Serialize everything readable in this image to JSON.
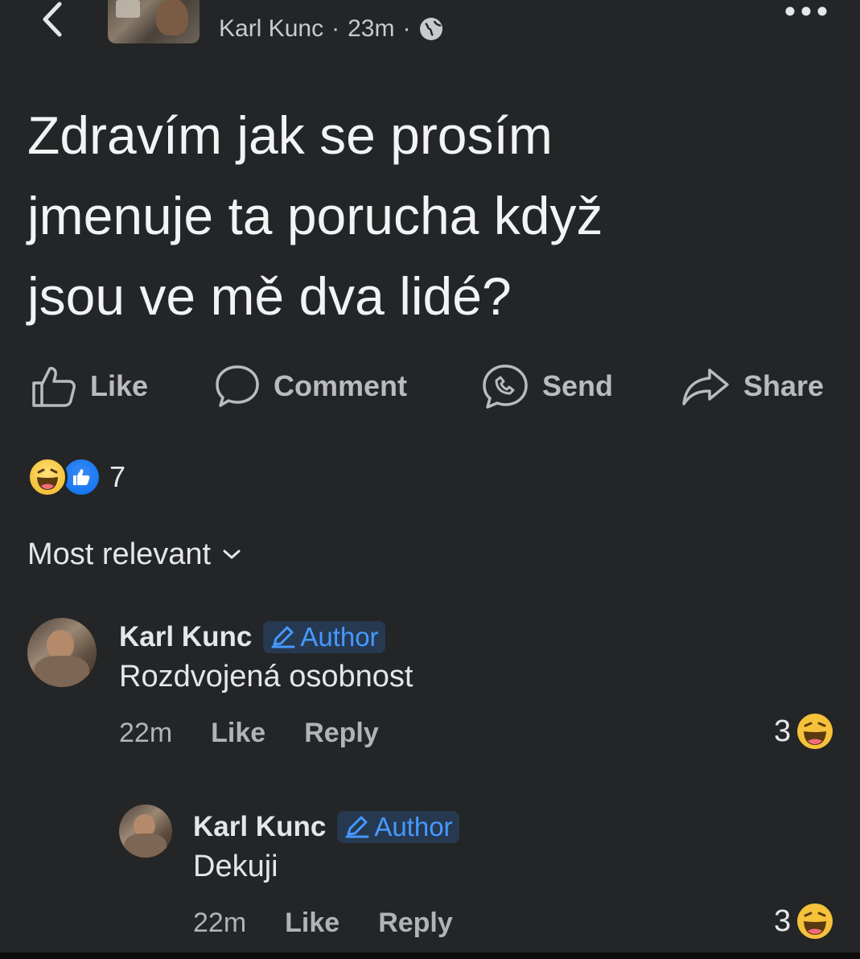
{
  "header": {
    "author": "Karl Kunc",
    "time": "23m",
    "separator": "·",
    "icons": {
      "back": "chevron-left-icon",
      "privacy": "globe-icon",
      "more": "more-horizontal-icon"
    }
  },
  "post": {
    "text": "Zdravím jak se prosím\njmenuje ta porucha když\njsou ve mě dva lidé?"
  },
  "actions": [
    {
      "label": "Like",
      "icon": "thumbs-up-icon"
    },
    {
      "label": "Comment",
      "icon": "comment-bubble-icon"
    },
    {
      "label": "Send",
      "icon": "messenger-icon"
    },
    {
      "label": "Share",
      "icon": "share-arrow-icon"
    }
  ],
  "reactions": {
    "count": "7",
    "types": [
      "haha",
      "like"
    ]
  },
  "sort": {
    "label": "Most relevant"
  },
  "comments": [
    {
      "author": "Karl Kunc",
      "badge": "Author",
      "text": "Rozdvojená osobnost",
      "time": "22m",
      "like": "Like",
      "reply": "Reply",
      "reactions": "3"
    },
    {
      "author": "Karl Kunc",
      "badge": "Author",
      "text": "Dekuji",
      "time": "22m",
      "like": "Like",
      "reply": "Reply",
      "reactions": "3"
    }
  ],
  "colors": {
    "background": "#242526",
    "text": "#e4e6eb",
    "muted": "#b0b3b8",
    "badge_bg": "#263951",
    "badge_fg": "#4599ff",
    "haha": "#f5c23a",
    "like": "#1877f2"
  }
}
